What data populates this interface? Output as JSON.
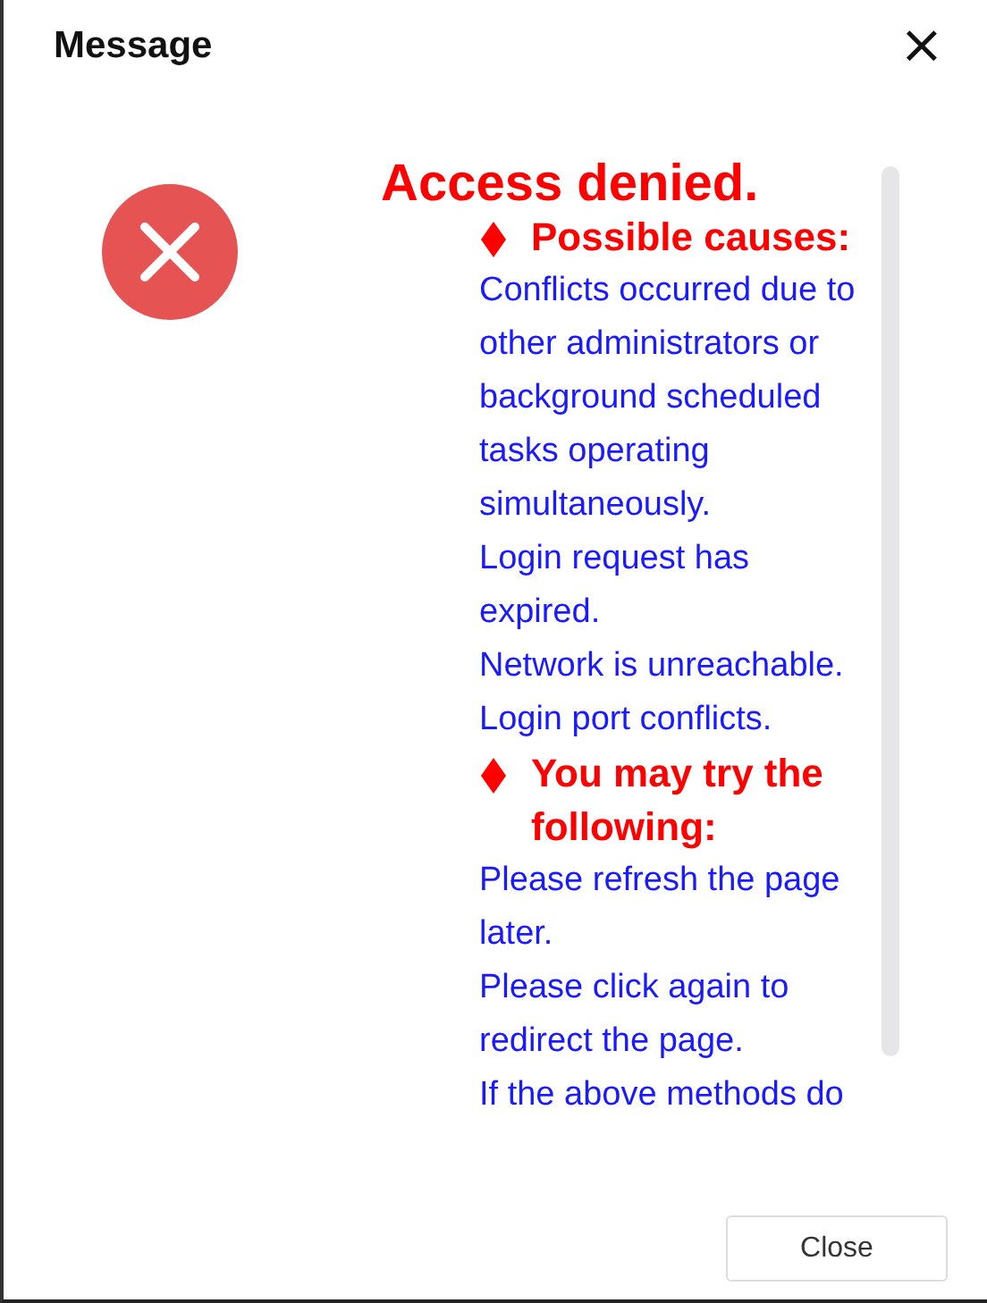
{
  "dialog": {
    "title": "Message",
    "close_icon": "×"
  },
  "message": {
    "title": "Access denied.",
    "sections": [
      {
        "heading": "Possible causes:",
        "lines": [
          "Conflicts occurred due to other administrators or background scheduled tasks operating simultaneously.",
          "Login request has expired.",
          "Network is unreachable.",
          "Login port conflicts."
        ]
      },
      {
        "heading": "You may try the following:",
        "lines": [
          "Please refresh the page later.",
          "Please click again to redirect the page.",
          "If the above methods do"
        ]
      }
    ]
  },
  "buttons": [
    {
      "label": "Close"
    }
  ]
}
